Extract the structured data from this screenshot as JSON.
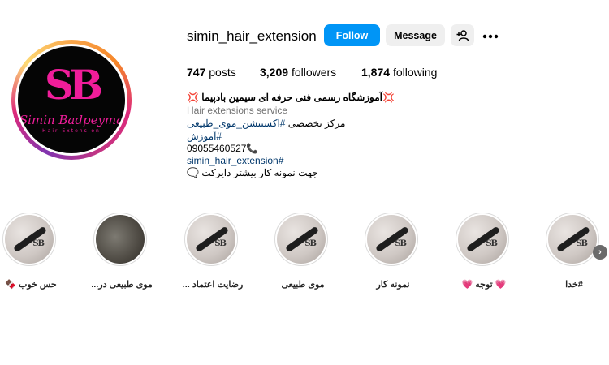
{
  "profile": {
    "username": "simin_hair_extension",
    "follow_label": "Follow",
    "message_label": "Message",
    "suggest_icon": "person-add-icon",
    "more_icon": "more-options-icon",
    "avatar": {
      "logo_letters": "SB",
      "logo_name": "Simin Badpeyma",
      "logo_subtitle": "Hair Extension"
    }
  },
  "stats": {
    "posts_count": "747",
    "posts_label": "posts",
    "followers_count": "3,209",
    "followers_label": "followers",
    "following_count": "1,874",
    "following_label": "following"
  },
  "bio": {
    "title": "💢آموزشگاه رسمی فنی حرفه ای سیمین بادپیما 💢",
    "category": "Hair extensions service",
    "line1_text": "مرکز تخصصی ",
    "line1_tag": "#اکستنشن_موی_طبیعی",
    "line2_tag": "#آموزش",
    "phone": "09055460527📞",
    "line4_tag": "simin_hair_extension#",
    "line5": "جهت نمونه کار بیشتر دایرکت 🗨️"
  },
  "highlights": [
    {
      "label": "حس خوب 🍫",
      "style": "light"
    },
    {
      "label": "موی طبیعی در...",
      "style": "dark"
    },
    {
      "label": "رضایت اعتماد ...",
      "style": "light"
    },
    {
      "label": "موی طبیعی",
      "style": "light"
    },
    {
      "label": "نمونه کار",
      "style": "light"
    },
    {
      "label": "💗 توجه 💗",
      "style": "light"
    },
    {
      "label": "#خدا",
      "style": "light"
    }
  ],
  "highlights_next_icon": "chevron-right-icon",
  "colors": {
    "follow_button": "#0095f6",
    "secondary_button": "#efefef",
    "brand_pink": "#f01d9a",
    "link": "#00376b",
    "muted": "#737373"
  }
}
